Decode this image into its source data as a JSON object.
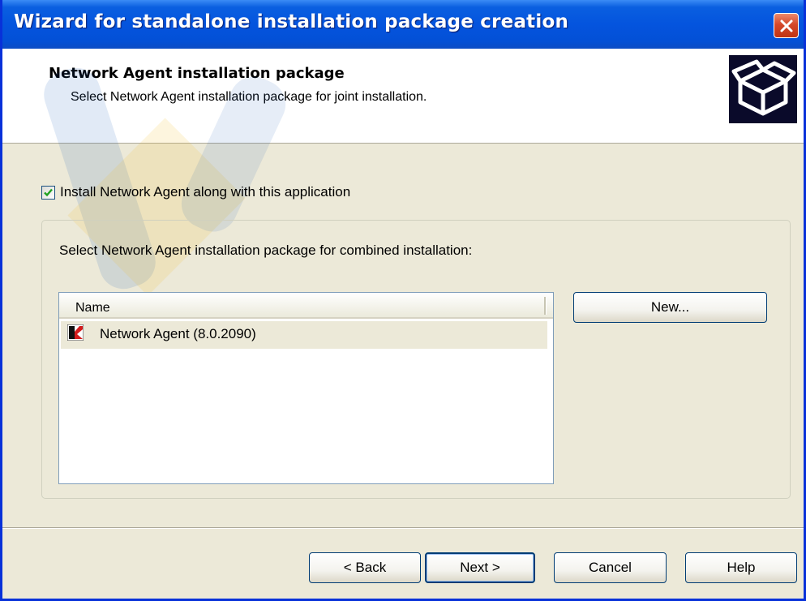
{
  "window": {
    "title": "Wizard for standalone installation package creation"
  },
  "header": {
    "title": "Network Agent installation package",
    "subtitle": "Select Network Agent installation package for joint installation.",
    "icon": "package-box-icon"
  },
  "options": {
    "install_agent_label": "Install Network Agent along with this application",
    "install_agent_checked": true
  },
  "group": {
    "label": "Select Network Agent installation package for combined installation:",
    "list": {
      "columns": [
        "Name"
      ],
      "rows": [
        {
          "name": "Network Agent (8.0.2090)",
          "icon": "kaspersky-icon",
          "selected": true
        }
      ]
    },
    "new_button": "New..."
  },
  "footer": {
    "back": "< Back",
    "next": "Next >",
    "cancel": "Cancel",
    "help": "Help"
  },
  "colors": {
    "titlebar": "#0454de",
    "dialog_bg": "#ece9d8",
    "close_button": "#d4482a",
    "button_border": "#003c74"
  }
}
